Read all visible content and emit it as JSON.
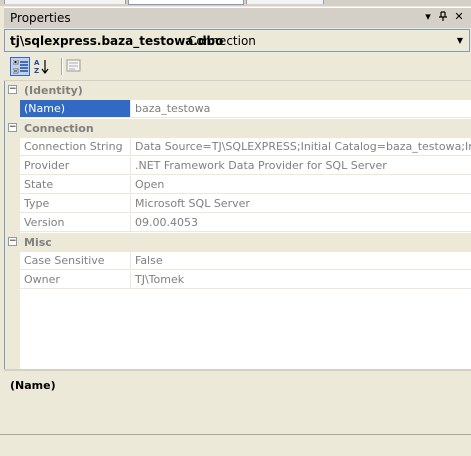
{
  "window": {
    "title": "Properties",
    "buttons": {
      "dropdown_icon": "chevron-down-icon",
      "pin_icon": "pin-icon",
      "close_icon": "close-icon"
    }
  },
  "object_selector": {
    "name": "tj\\sqlexpress.baza_testowa.dbo",
    "type": "Connection"
  },
  "toolbar": {
    "buttons": [
      {
        "name": "categorized-button",
        "icon": "categorized-icon",
        "selected": true
      },
      {
        "name": "alphabetical-button",
        "icon": "sort-az-icon",
        "selected": false
      },
      {
        "name": "property-pages-button",
        "icon": "property-pages-icon",
        "selected": false
      }
    ]
  },
  "grid": {
    "categories": [
      {
        "label": "(Identity)",
        "expander": "−",
        "properties": [
          {
            "name": "(Name)",
            "value": "baza_testowa",
            "selected": true
          }
        ]
      },
      {
        "label": "Connection",
        "expander": "−",
        "properties": [
          {
            "name": "Connection String",
            "value": "Data Source=TJ\\SQLEXPRESS;Initial Catalog=baza_testowa;Integ"
          },
          {
            "name": "Provider",
            "value": ".NET Framework Data Provider for SQL Server"
          },
          {
            "name": "State",
            "value": "Open"
          },
          {
            "name": "Type",
            "value": "Microsoft SQL Server"
          },
          {
            "name": "Version",
            "value": "09.00.4053"
          }
        ]
      },
      {
        "label": "Misc",
        "expander": "−",
        "properties": [
          {
            "name": "Case Sensitive",
            "value": "False"
          },
          {
            "name": "Owner",
            "value": "TJ\\Tomek"
          }
        ]
      }
    ]
  },
  "description": {
    "title": "(Name)"
  },
  "colors": {
    "selection": "#316ac5",
    "panel": "#ece9d8",
    "grey_text": "#808080"
  }
}
